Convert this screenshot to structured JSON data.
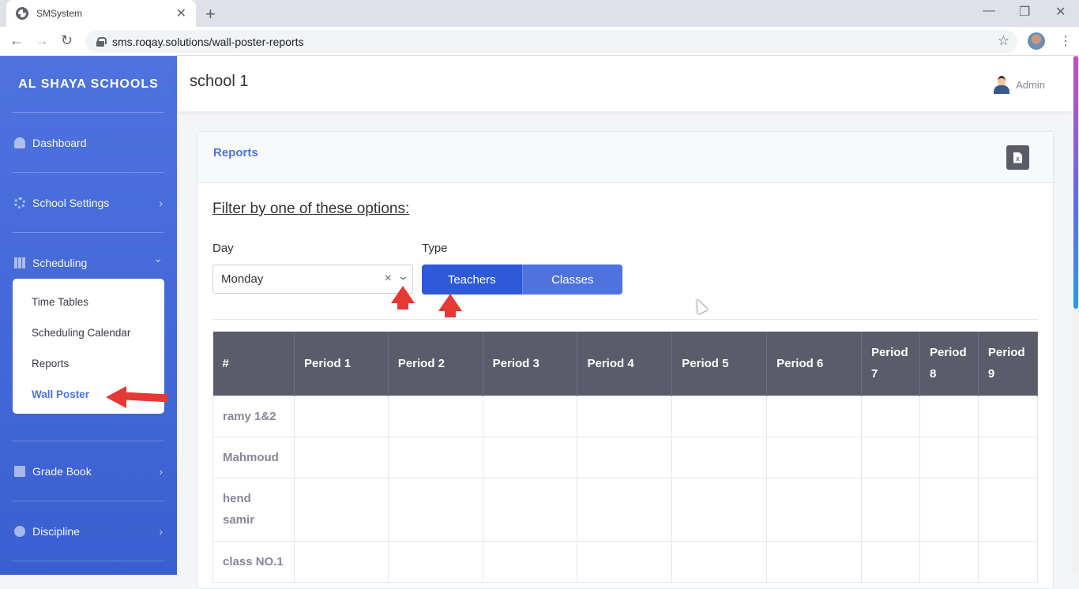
{
  "browser": {
    "tab_title": "SMSystem",
    "tab_close": "✕",
    "new_tab": "+",
    "url": "sms.roqay.solutions/wall-poster-reports",
    "controls": {
      "minimize": "—",
      "restore": "❐",
      "close": "✕"
    },
    "nav": {
      "back": "←",
      "forward": "→",
      "reload": "↻"
    },
    "star": "☆",
    "menu": "⋮"
  },
  "sidebar": {
    "brand": "AL SHAYA SCHOOLS",
    "items": [
      {
        "label": "Dashboard",
        "icon": "dashboard-icon"
      },
      {
        "label": "School Settings",
        "icon": "gear-icon"
      },
      {
        "label": "Scheduling",
        "icon": "table-icon"
      },
      {
        "label": "Grade Book",
        "icon": "book-icon"
      },
      {
        "label": "Discipline",
        "icon": "face-icon"
      }
    ],
    "submenu": [
      "Time Tables",
      "Scheduling Calendar",
      "Reports",
      "Wall Poster"
    ],
    "active_submenu": "Wall Poster",
    "chevron_right": "›",
    "chevron_down": "⌄"
  },
  "topbar": {
    "school": "school 1",
    "user": "Admin"
  },
  "card": {
    "title": "Reports",
    "export_icon": "excel-icon",
    "export_letter": "X",
    "filter_title": "Filter by one of these options:",
    "day_label": "Day",
    "day_value": "Monday",
    "type_label": "Type",
    "clear": "×",
    "dropdown": "⌄",
    "type_options": [
      "Teachers",
      "Classes"
    ],
    "type_selected": "Teachers"
  },
  "table": {
    "headers": [
      "#",
      "Period 1",
      "Period 2",
      "Period 3",
      "Period 4",
      "Period 5",
      "Period 6",
      "Period 7",
      "Period 8",
      "Period 9"
    ],
    "rows": [
      "ramy 1&2",
      "Mahmoud",
      "hend samir",
      "class NO.1"
    ]
  },
  "colors": {
    "sidebar": "#4e73df",
    "accent": "#2e59d9",
    "table_header": "#5a5c69",
    "annotation": "#e53935"
  }
}
